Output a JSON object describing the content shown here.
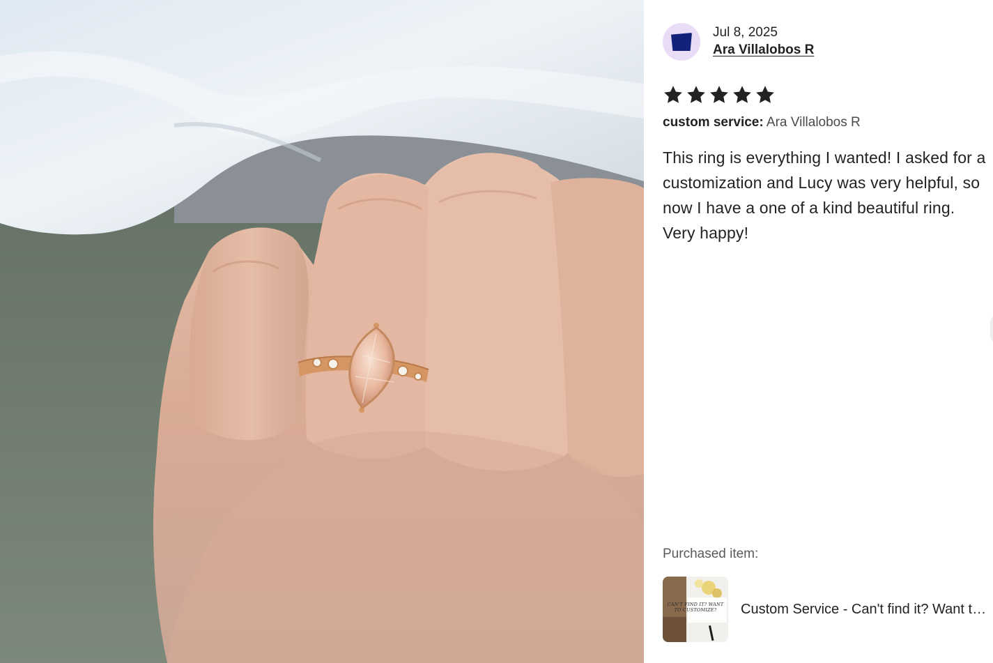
{
  "photo": {
    "subject": "ring-on-hand-photo"
  },
  "review": {
    "date": "Jul 8, 2025",
    "reviewer_name": "Ara Villalobos R",
    "rating": 5,
    "rating_max": 5,
    "variation_label": "custom service:",
    "variation_value": "Ara Villalobos R",
    "text": "This ring is everything I wanted! I asked for a customization and Lucy was very helpful, so now I have a one of a kind beautiful ring. Very happy!"
  },
  "purchased": {
    "label": "Purchased item:",
    "thumb_text": "CAN'T FIND IT? WANT TO CUSTOMIZE?",
    "title": "Custom Service - Can't find it? Want to customize?"
  },
  "colors": {
    "avatar_bg": "#e9dcf7",
    "avatar_shape": "#12227a",
    "star": "#222222",
    "text": "#222222",
    "muted": "#595959"
  }
}
